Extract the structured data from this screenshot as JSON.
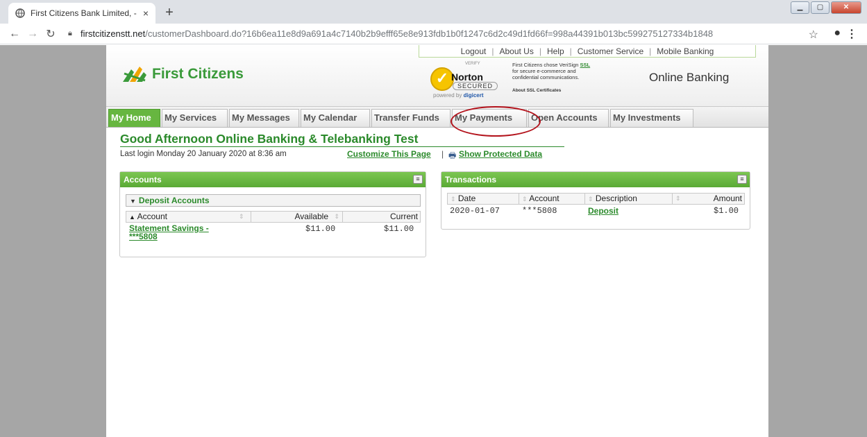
{
  "browser": {
    "tab_title": "First Citizens Bank Limited, - Hon",
    "tab_close": "×",
    "new_tab": "+",
    "url_host": "firstcitizenstt.net",
    "url_path": "/customerDashboard.do?16b6ea11e8d9a691a4c7140b2b9efff65e8e913fdb1b0f1247c6d2c49d1fd66f=998a44391b013bc599275127334b1848"
  },
  "utility_links": [
    "Logout",
    "About Us",
    "Help",
    "Customer Service",
    "Mobile Banking"
  ],
  "brand": {
    "name": "First Citizens",
    "tagline": "Online Banking",
    "accent_color": "#3a9a3a"
  },
  "norton": {
    "verify": "VERIFY",
    "name": "Norton",
    "secured": "SECURED",
    "powered_prefix": "powered by ",
    "powered_brand": "digicert"
  },
  "ssl_note": {
    "line1": "First Citizens chose VeriSign ",
    "ssl_link": "SSL",
    "line2": "for secure e-commerce and",
    "line3": "confidential communications.",
    "about": "About SSL Certificates"
  },
  "nav_tabs": [
    {
      "label": "My Home",
      "active": true
    },
    {
      "label": "My Services"
    },
    {
      "label": "My Messages"
    },
    {
      "label": "My Calendar"
    },
    {
      "label": "Transfer Funds"
    },
    {
      "label": "My Payments"
    },
    {
      "label": "Open Accounts"
    },
    {
      "label": "My Investments"
    }
  ],
  "greeting": "Good Afternoon Online Banking & Telebanking Test",
  "last_login": "Last login Monday 20 January 2020 at 8:36 am",
  "customize_link": "Customize This Page",
  "separator": "|",
  "show_protected": "Show Protected Data",
  "accounts_panel": {
    "title": "Accounts",
    "group": "Deposit Accounts",
    "columns": [
      "Account",
      "Available",
      "Current"
    ],
    "rows": [
      {
        "account_line1": "Statement Savings -",
        "account_line2": "***5808",
        "available": "$11.00",
        "current": "$11.00"
      }
    ]
  },
  "transactions_panel": {
    "title": "Transactions",
    "columns": [
      "Date",
      "Account",
      "Description",
      "Amount"
    ],
    "rows": [
      {
        "date": "2020-01-07",
        "account": "***5808",
        "description": "Deposit",
        "amount": "$1.00"
      }
    ]
  }
}
